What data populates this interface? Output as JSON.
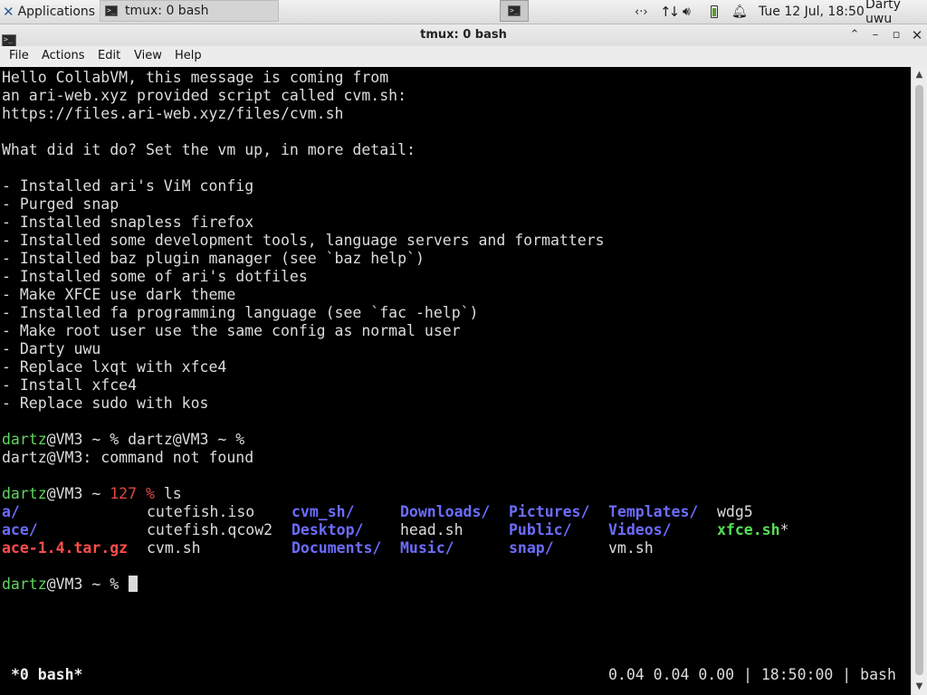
{
  "panel": {
    "applications_label": "Applications",
    "task_label": "tmux: 0 bash",
    "clock": "Tue 12 Jul, 18:50",
    "user": "Darty uwu",
    "icons": {
      "logo": "xfce-mouse-icon",
      "network": "network-icon",
      "transfer": "up-down-arrows-icon",
      "volume": "speaker-icon",
      "battery": "battery-icon",
      "notifications": "bell-icon"
    }
  },
  "window": {
    "title": "tmux: 0 bash",
    "menu": {
      "file": "File",
      "actions": "Actions",
      "edit": "Edit",
      "view": "View",
      "help": "Help"
    }
  },
  "terminal": {
    "lines": [
      "Hello CollabVM, this message is coming from",
      "an ari-web.xyz provided script called cvm.sh:",
      "https://files.ari-web.xyz/files/cvm.sh",
      "",
      "What did it do? Set the vm up, in more detail:",
      "",
      "- Installed ari's ViM config",
      "- Purged snap",
      "- Installed snapless firefox",
      "- Installed some development tools, language servers and formatters",
      "- Installed baz plugin manager (see `baz help`)",
      "- Installed some of ari's dotfiles",
      "- Make XFCE use dark theme",
      "- Installed fa programming language (see `fac -help`)",
      "- Make root user use the same config as normal user",
      "- Darty uwu",
      "- Replace lxqt with xfce4",
      "- Install xfce4",
      "- Replace sudo with kos"
    ],
    "prompt1": {
      "user": "dartz",
      "host": "@VM3 ~ % ",
      "cmd": "dartz@VM3 ~ %"
    },
    "error_line": "dartz@VM3: command not found",
    "prompt2": {
      "user": "dartz",
      "host": "@VM3 ~ ",
      "status": "127 %",
      "cmd": " ls"
    },
    "ls": {
      "col1": [
        "a/",
        "ace/",
        "ace-1.4.tar.gz"
      ],
      "col2": [
        "cutefish.iso",
        "cutefish.qcow2",
        "cvm.sh"
      ],
      "col3": [
        "cvm_sh/",
        "Desktop/",
        "Documents/"
      ],
      "col4": [
        "Downloads/",
        "head.sh",
        "Music/"
      ],
      "col5": [
        "Pictures/",
        "Public/",
        "snap/"
      ],
      "col6": [
        "Templates/",
        "Videos/",
        "vm.sh"
      ],
      "col7": [
        "wdg5",
        "xfce.sh",
        ""
      ],
      "exec_mark": "*"
    },
    "prompt3": {
      "user": "dartz",
      "host": "@VM3 ~ % "
    },
    "status_left": "*0 bash*",
    "status_right": "0.04 0.04 0.00 | 18:50:00 | bash"
  }
}
